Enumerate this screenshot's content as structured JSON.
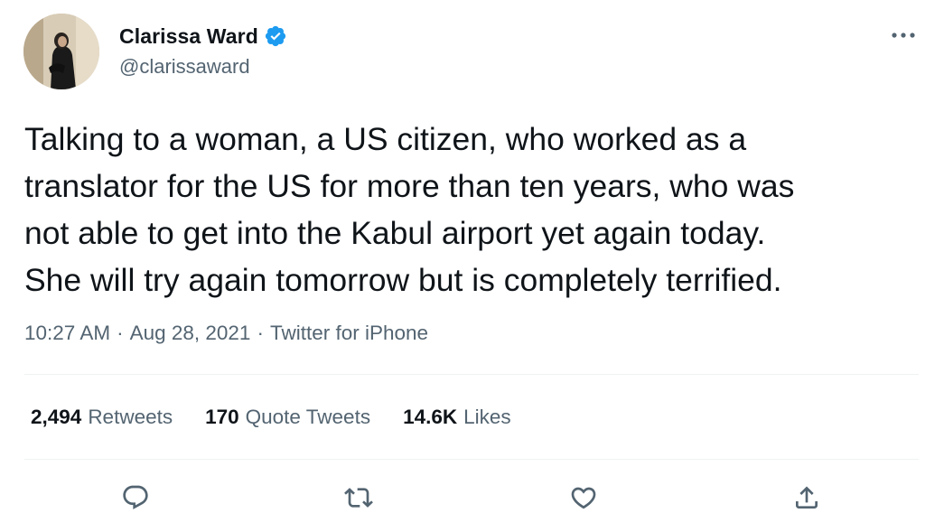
{
  "author": {
    "display_name": "Clarissa Ward",
    "handle": "@clarissaward",
    "avatar_icon": "profile-photo",
    "verified_icon": "verified-badge-icon",
    "verified_color": "#1d9bf0"
  },
  "tweet": {
    "text": "Talking to a woman, a US citizen, who worked as a\ntranslator for the US for more than ten years, who was\nnot able to get into the Kabul airport yet again today.\nShe will try again tomorrow but is completely terrified."
  },
  "meta": {
    "time": "10:27 AM",
    "separator": "·",
    "date": "Aug 28, 2021",
    "source": "Twitter for iPhone"
  },
  "stats": {
    "retweets": {
      "count": "2,494",
      "label": "Retweets"
    },
    "quote_tweets": {
      "count": "170",
      "label": "Quote Tweets"
    },
    "likes": {
      "count": "14.6K",
      "label": "Likes"
    }
  },
  "actions": {
    "reply_icon": "reply-icon",
    "retweet_icon": "retweet-icon",
    "like_icon": "heart-icon",
    "share_icon": "share-icon",
    "icon_color": "#536471"
  },
  "colors": {
    "text_primary": "#0f1419",
    "text_secondary": "#536471",
    "divider": "#eff3f4"
  }
}
